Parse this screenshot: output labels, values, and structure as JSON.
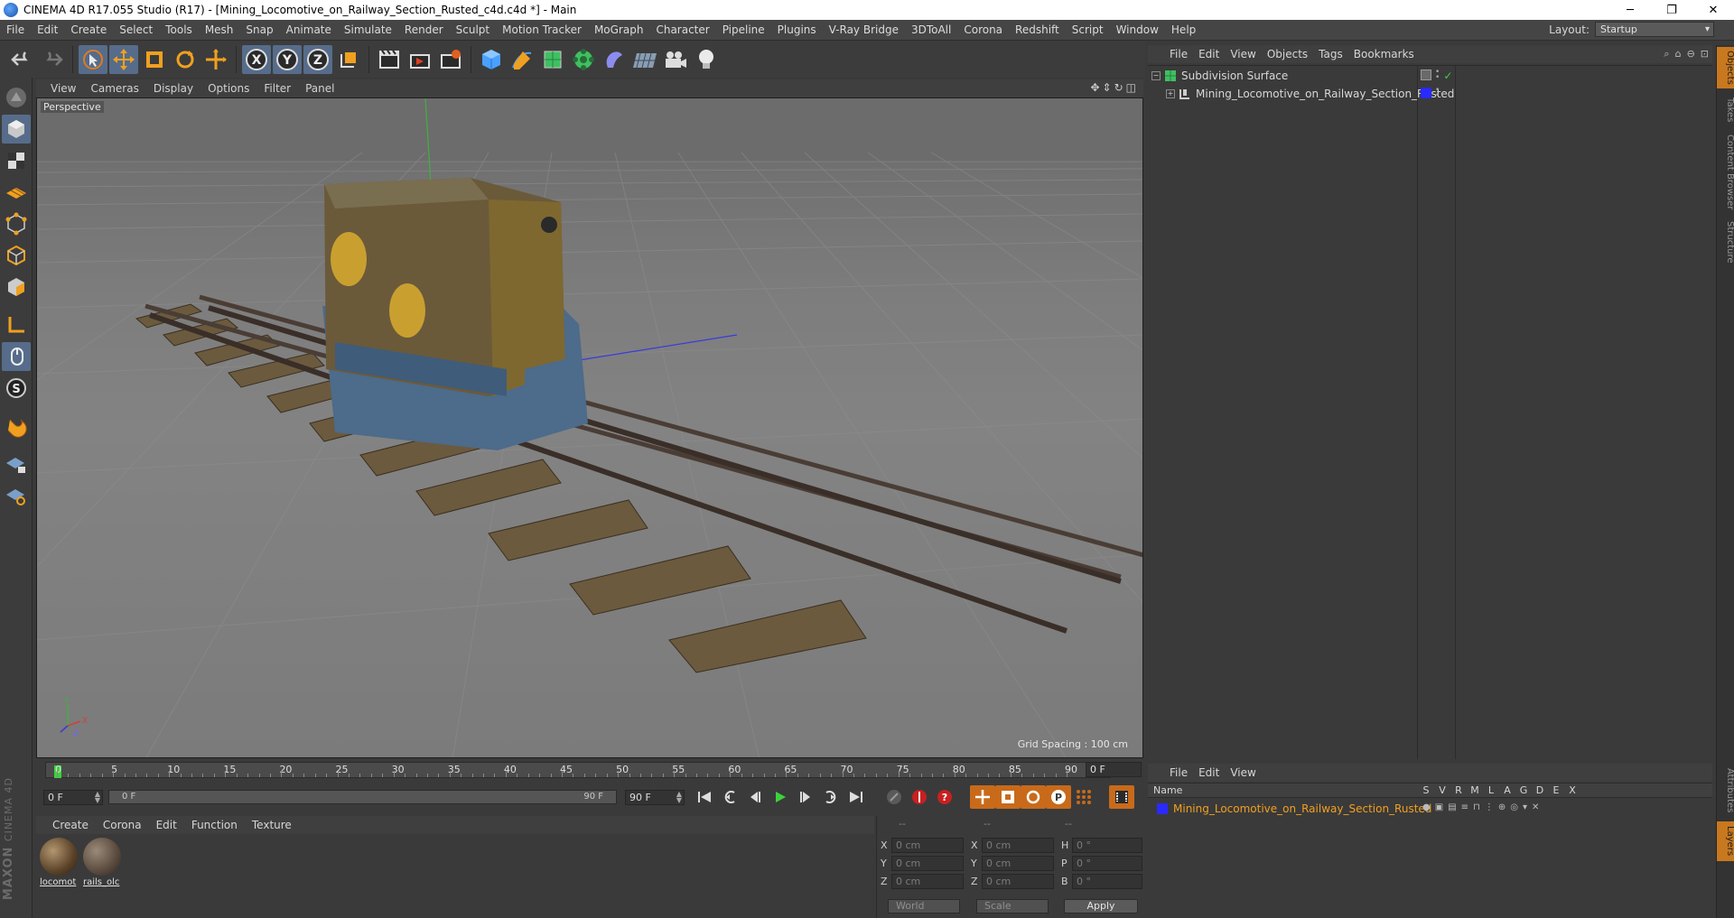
{
  "window": {
    "title": "CINEMA 4D R17.055 Studio (R17) - [Mining_Locomotive_on_Railway_Section_Rusted_c4d.c4d *] - Main",
    "minimize": "─",
    "maximize": "❐",
    "close": "✕"
  },
  "menu": {
    "items": [
      "File",
      "Edit",
      "Create",
      "Select",
      "Tools",
      "Mesh",
      "Snap",
      "Animate",
      "Simulate",
      "Render",
      "Sculpt",
      "Motion Tracker",
      "MoGraph",
      "Character",
      "Pipeline",
      "Plugins",
      "V-Ray Bridge",
      "3DToAll",
      "Corona",
      "Redshift",
      "Script",
      "Window",
      "Help"
    ],
    "layout_label": "Layout:",
    "layout_value": "Startup"
  },
  "viewport": {
    "menu": [
      "View",
      "Cameras",
      "Display",
      "Options",
      "Filter",
      "Panel"
    ],
    "label": "Perspective",
    "grid_spacing": "Grid Spacing : 100 cm"
  },
  "timeline": {
    "frames": [
      "0",
      "5",
      "10",
      "15",
      "20",
      "25",
      "30",
      "35",
      "40",
      "45",
      "50",
      "55",
      "60",
      "65",
      "70",
      "75",
      "80",
      "85",
      "90"
    ],
    "end_field": "0 F",
    "current_frame": 0,
    "max_frame": 90
  },
  "transport": {
    "start_field": "0 F",
    "range_start": "0 F",
    "range_end": "90 F",
    "end_field": "90 F"
  },
  "materials": {
    "menu": [
      "Create",
      "Corona",
      "Edit",
      "Function",
      "Texture"
    ],
    "items": [
      {
        "name": "locomot"
      },
      {
        "name": "rails_olc"
      }
    ]
  },
  "coordinates": {
    "headers": [
      "--",
      "--",
      "--"
    ],
    "rows": [
      {
        "a1": "X",
        "v1": "0 cm",
        "a2": "X",
        "v2": "0 cm",
        "a3": "H",
        "v3": "0 °"
      },
      {
        "a1": "Y",
        "v1": "0 cm",
        "a2": "Y",
        "v2": "0 cm",
        "a3": "P",
        "v3": "0 °"
      },
      {
        "a1": "Z",
        "v1": "0 cm",
        "a2": "Z",
        "v2": "0 cm",
        "a3": "B",
        "v3": "0 °"
      }
    ],
    "space": "World",
    "mode": "Scale",
    "apply": "Apply"
  },
  "object_manager": {
    "menu": [
      "File",
      "Edit",
      "View",
      "Objects",
      "Tags",
      "Bookmarks"
    ],
    "objects": [
      {
        "name": "Subdivision Surface"
      },
      {
        "name": "Mining_Locomotive_on_Railway_Section_Rusted"
      }
    ]
  },
  "layer_manager": {
    "menu": [
      "File",
      "Edit",
      "View"
    ],
    "name_header": "Name",
    "columns": [
      "S",
      "V",
      "R",
      "M",
      "L",
      "A",
      "G",
      "D",
      "E",
      "X"
    ],
    "layers": [
      {
        "name": "Mining_Locomotive_on_Railway_Section_Rusted",
        "color": "#2a2aff"
      }
    ]
  },
  "side_tabs": [
    "Objects",
    "Takes",
    "Content Browser",
    "Structure",
    "Attributes",
    "Layers"
  ],
  "colors": {
    "accent": "#566c8a",
    "layer_text": "#f0a020",
    "playhead": "#3dd13d",
    "tab_active": "#c8781f"
  }
}
